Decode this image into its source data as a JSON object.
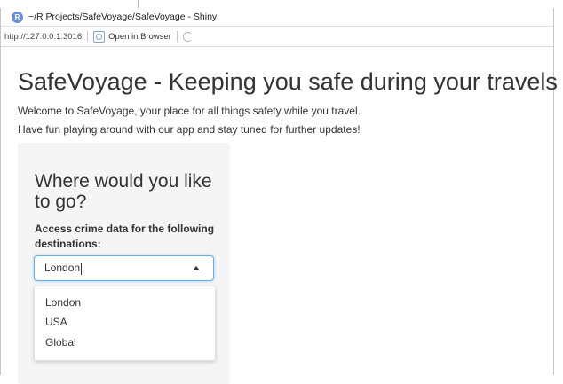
{
  "window": {
    "title": "~/R Projects/SafeVoyage/SafeVoyage - Shiny"
  },
  "toolbar": {
    "url": "http://127.0.0.1:3016",
    "open_browser_label": "Open in Browser"
  },
  "page": {
    "title": "SafeVoyage - Keeping you safe during your travels",
    "intro_line1": "Welcome to SafeVoyage, your place for all things safety while you travel.",
    "intro_line2": "Have fun playing around with our app and stay tuned for further updates!"
  },
  "panel": {
    "heading": "Where would you like to go?",
    "label": "Access crime data for the following destinations:",
    "select_value": "London",
    "options": [
      "London",
      "USA",
      "Global"
    ]
  }
}
